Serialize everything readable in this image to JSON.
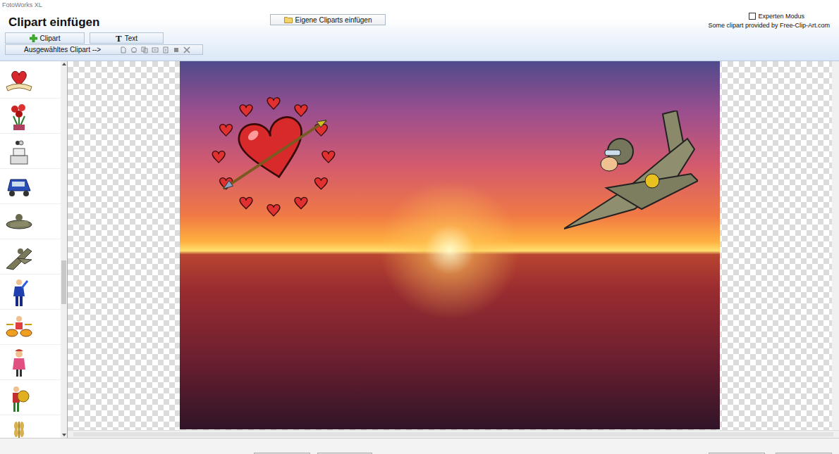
{
  "window": {
    "title": "FotoWorks XL"
  },
  "page": {
    "title": "Clipart einfügen"
  },
  "toolbar": {
    "buttons": [
      {
        "label": "Clipart",
        "kind": "plus",
        "icon": ""
      },
      {
        "label": "Text",
        "kind": "glyph",
        "icon": "T"
      }
    ]
  },
  "selected_clipart": {
    "label": "Ausgewähltes Clipart -->",
    "tools": [
      {
        "kind": "page",
        "disabled": true
      },
      {
        "kind": "rotate",
        "disabled": true
      },
      {
        "kind": "copy",
        "disabled": true
      },
      {
        "kind": "front",
        "disabled": true
      },
      {
        "kind": "back",
        "disabled": true
      },
      {
        "kind": "layer",
        "disabled": true
      },
      {
        "kind": "delete",
        "disabled": true
      }
    ]
  },
  "own_cliparts_button": {
    "label": "Eigene Cliparts einfügen"
  },
  "expert_mode": {
    "label": "Experten Modus",
    "checked": false
  },
  "credit": "Some clipart provided by Free-Clip-Art.com"
}
